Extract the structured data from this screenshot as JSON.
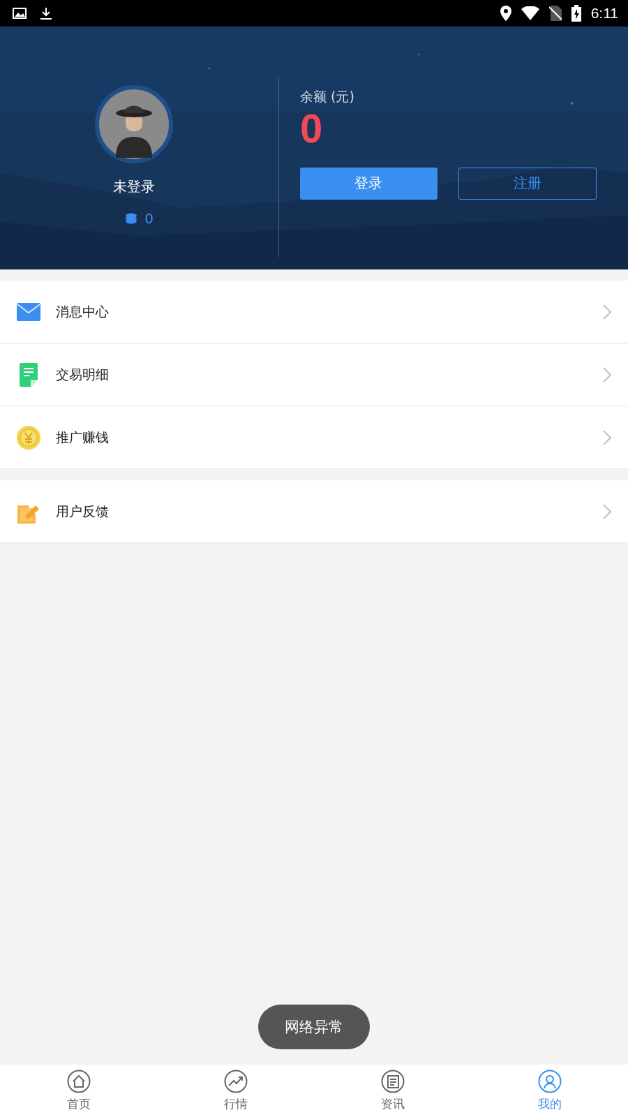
{
  "status_bar": {
    "time": "6:11"
  },
  "profile": {
    "name": "未登录",
    "coins": "0",
    "balance_label": "余额 (元)",
    "balance": "0",
    "buttons": [
      {
        "label": "登录",
        "kind": "primary"
      },
      {
        "label": "注册",
        "kind": "outline"
      }
    ]
  },
  "menu_groups": [
    [
      {
        "label": "消息中心",
        "kind": "mail"
      },
      {
        "label": "交易明细",
        "kind": "doc"
      },
      {
        "label": "推广赚钱",
        "kind": "coin"
      }
    ],
    [
      {
        "label": "用户反馈",
        "kind": "edit"
      }
    ]
  ],
  "toast": "网络异常",
  "tabs": [
    {
      "label": "首页",
      "kind": "home",
      "selected": false
    },
    {
      "label": "行情",
      "kind": "trend",
      "selected": false
    },
    {
      "label": "资讯",
      "kind": "news",
      "selected": false
    },
    {
      "label": "我的",
      "kind": "user",
      "selected": true
    }
  ]
}
